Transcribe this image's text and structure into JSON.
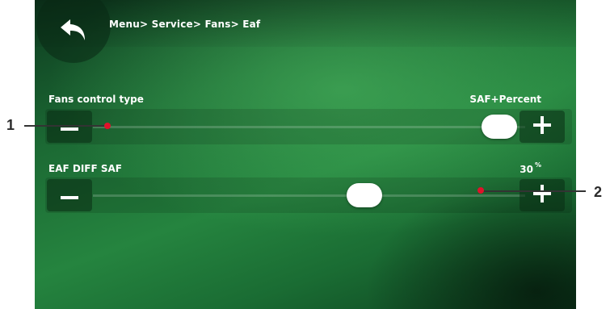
{
  "header": {
    "breadcrumb": "Menu> Service> Fans> Eaf",
    "back_icon": "back-arrow-icon"
  },
  "settings": [
    {
      "label": "Fans control type",
      "value": "SAF+Percent",
      "unit": "",
      "slider_level": 1.0
    },
    {
      "label": "EAF DIFF SAF",
      "value": "30",
      "unit": "%",
      "slider_level": 0.5
    }
  ],
  "callouts": [
    "1",
    "2"
  ],
  "colors": {
    "background": "#1c6a34",
    "accent_text": "#ffffff",
    "callout_dot": "#e0122a"
  }
}
